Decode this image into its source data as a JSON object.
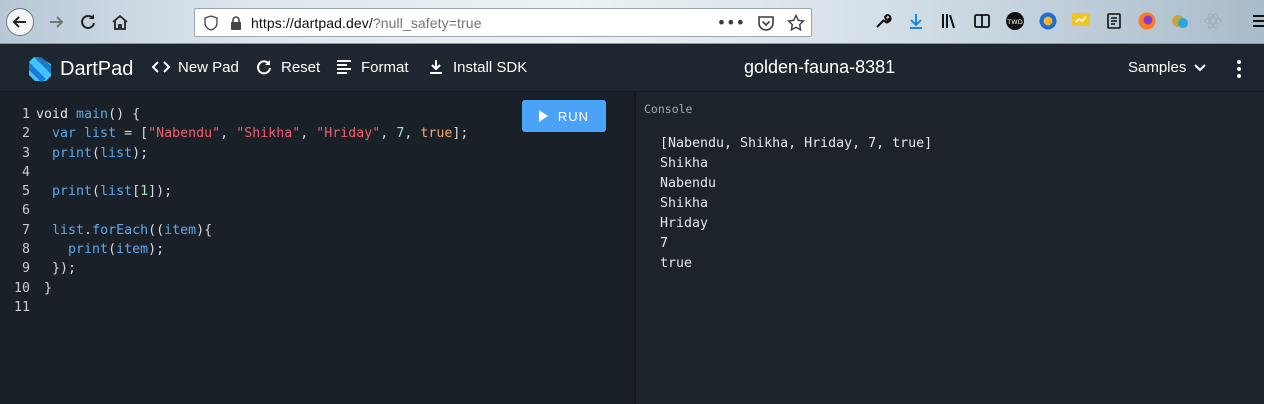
{
  "browser": {
    "url_host": "https://dartpad.dev/",
    "url_path": "?null_safety=true",
    "page_actions_glyph": "•••",
    "toolbar_icons": [
      "wrench-icon",
      "download-icon",
      "library-icon",
      "reader-icon",
      "twd-extension-icon",
      "globe-extension-icon",
      "screenshot-extension-icon",
      "notes-extension-icon",
      "firefox-icon",
      "coin-extension-icon",
      "react-devtools-icon",
      "hamburger-menu-icon"
    ],
    "twd_label": "TWD"
  },
  "header": {
    "brand": "DartPad",
    "new_pad": "New Pad",
    "reset": "Reset",
    "format": "Format",
    "install_sdk": "Install SDK",
    "pad_name": "golden-fauna-8381",
    "samples": "Samples"
  },
  "editor": {
    "run_label": "RUN",
    "line_numbers": [
      "1",
      "2",
      "3",
      "4",
      "5",
      "6",
      "7",
      "8",
      "9",
      "10",
      "11"
    ],
    "lines": [
      [
        {
          "t": "void ",
          "c": "k"
        },
        {
          "t": "main",
          "c": "v"
        },
        {
          "t": "() {",
          "c": "p"
        }
      ],
      [
        {
          "t": "  var ",
          "c": "v"
        },
        {
          "t": "list",
          "c": "v"
        },
        {
          "t": " = [",
          "c": "p"
        },
        {
          "t": "\"Nabendu\"",
          "c": "s"
        },
        {
          "t": ", ",
          "c": "p"
        },
        {
          "t": "\"Shikha\"",
          "c": "s"
        },
        {
          "t": ", ",
          "c": "p"
        },
        {
          "t": "\"Hriday\"",
          "c": "s"
        },
        {
          "t": ", ",
          "c": "p"
        },
        {
          "t": "7",
          "c": "n"
        },
        {
          "t": ", ",
          "c": "p"
        },
        {
          "t": "true",
          "c": "b"
        },
        {
          "t": "];",
          "c": "p"
        }
      ],
      [
        {
          "t": "  print",
          "c": "v"
        },
        {
          "t": "(",
          "c": "p"
        },
        {
          "t": "list",
          "c": "v"
        },
        {
          "t": ");",
          "c": "p"
        }
      ],
      [],
      [
        {
          "t": "  print",
          "c": "v"
        },
        {
          "t": "(",
          "c": "p"
        },
        {
          "t": "list",
          "c": "v"
        },
        {
          "t": "[",
          "c": "p"
        },
        {
          "t": "1",
          "c": "n"
        },
        {
          "t": "]);",
          "c": "p"
        }
      ],
      [],
      [
        {
          "t": "  list",
          "c": "v"
        },
        {
          "t": ".",
          "c": "p"
        },
        {
          "t": "forEach",
          "c": "v"
        },
        {
          "t": "((",
          "c": "p"
        },
        {
          "t": "item",
          "c": "v"
        },
        {
          "t": "){",
          "c": "p"
        }
      ],
      [
        {
          "t": "    print",
          "c": "v"
        },
        {
          "t": "(",
          "c": "p"
        },
        {
          "t": "item",
          "c": "v"
        },
        {
          "t": ");",
          "c": "p"
        }
      ],
      [
        {
          "t": "  });",
          "c": "p"
        }
      ],
      [
        {
          "t": " }",
          "c": "p"
        }
      ],
      []
    ]
  },
  "console": {
    "label": "Console",
    "output": [
      "[Nabendu, Shikha, Hriday, 7, true]",
      "Shikha",
      "Nabendu",
      "Shikha",
      "Hriday",
      "7",
      "true"
    ]
  },
  "colors": {
    "run_button": "#4aa3f6",
    "header_bg": "#1e262f",
    "editor_bg": "#1a2027",
    "console_bg": "#1d232b",
    "string": "#f05d6f",
    "identifier": "#5fa8ea",
    "number": "#a9e3c4",
    "bool": "#f2a66a"
  }
}
